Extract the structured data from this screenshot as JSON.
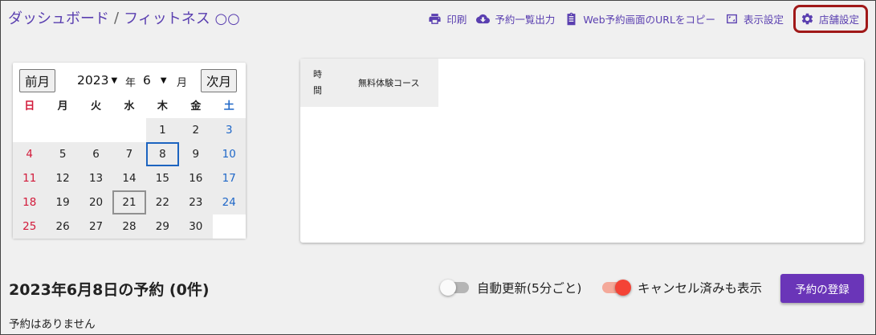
{
  "breadcrumb": {
    "parent": "ダッシュボード",
    "separator": "/",
    "current": "フィットネス ○○"
  },
  "toolbar": [
    {
      "icon": "print-icon",
      "label": "印刷"
    },
    {
      "icon": "cloud-download-icon",
      "label": "予約一覧出力"
    },
    {
      "icon": "clipboard-icon",
      "label": "Web予約画面のURLをコピー"
    },
    {
      "icon": "fullscreen-icon",
      "label": "表示設定"
    },
    {
      "icon": "gear-icon",
      "label": "店舗設定"
    }
  ],
  "calendar": {
    "prev_label": "前月",
    "next_label": "次月",
    "year": "2023",
    "year_suffix": "年",
    "month": "6",
    "month_suffix": "月",
    "weekdays": [
      "日",
      "月",
      "火",
      "水",
      "木",
      "金",
      "土"
    ],
    "weeks": [
      [
        "",
        "",
        "",
        "",
        "1",
        "2",
        "3"
      ],
      [
        "4",
        "5",
        "6",
        "7",
        "8",
        "9",
        "10"
      ],
      [
        "11",
        "12",
        "13",
        "14",
        "15",
        "16",
        "17"
      ],
      [
        "18",
        "19",
        "20",
        "21",
        "22",
        "23",
        "24"
      ],
      [
        "25",
        "26",
        "27",
        "28",
        "29",
        "30",
        ""
      ]
    ],
    "today": "8",
    "selected": "21"
  },
  "schedule": {
    "time_header": "時間",
    "course_header": "無料体験コース"
  },
  "reservations": {
    "title": "2023年6月8日の予約 (0件)",
    "auto_refresh_label": "自動更新(5分ごと)",
    "auto_refresh_on": false,
    "show_cancelled_label": "キャンセル済みも表示",
    "show_cancelled_on": true,
    "register_label": "予約の登録",
    "empty_message": "予約はありません"
  },
  "colors": {
    "accent": "#6a35b8",
    "link": "#5a3fb0",
    "sunday": "#d21a3a",
    "saturday": "#2068c8",
    "highlight": "#a01818"
  }
}
